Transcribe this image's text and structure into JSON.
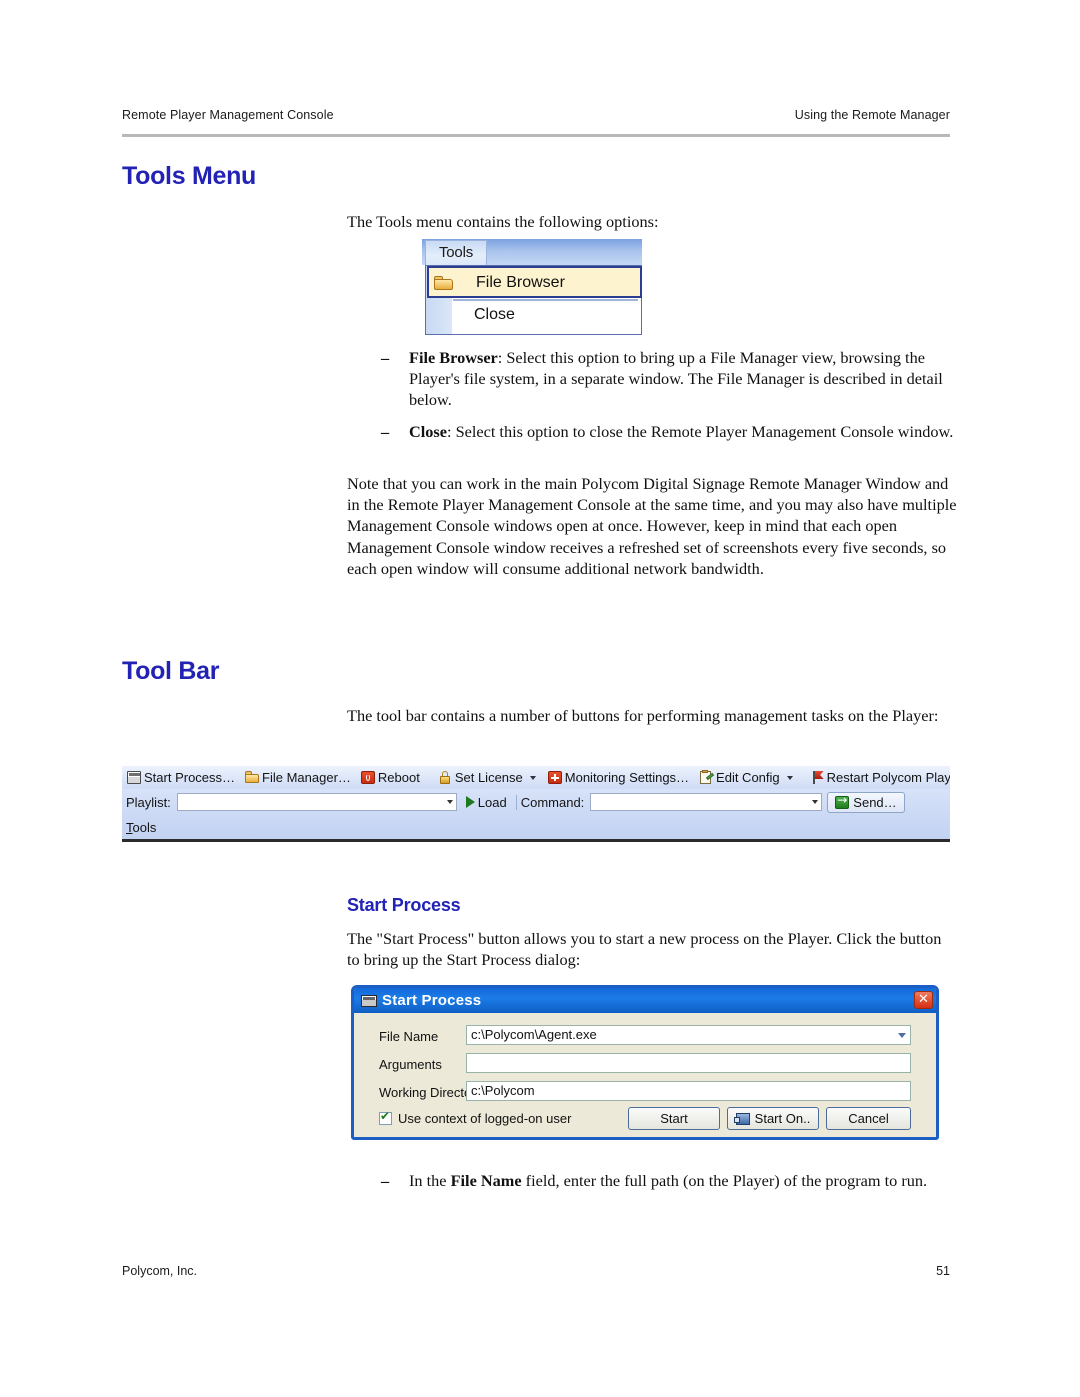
{
  "header": {
    "left": "Remote Player Management Console",
    "right": "Using the Remote Manager"
  },
  "footer": {
    "company": "Polycom, Inc.",
    "page_number": "51"
  },
  "sections": {
    "tools_menu": {
      "heading": "Tools Menu",
      "intro": "The Tools menu contains the following options:",
      "bullets": [
        {
          "term": "File Browser",
          "text": ": Select this option to bring up a File Manager view, browsing the Player's file system, in a separate window. The File Manager is described in detail below."
        },
        {
          "term": "Close",
          "text": ": Select this option to close the Remote Player Management Console window."
        }
      ],
      "note": "Note that you can work in the main Polycom Digital Signage Remote Manager Window and in the Remote Player Management Console at the same time, and you may also have multiple Management Console windows open at once. However, keep in mind that each open Management Console window receives a refreshed set of screenshots every five seconds, so each open window will consume additional network bandwidth."
    },
    "tool_bar": {
      "heading": "Tool Bar",
      "intro": "The tool bar contains a number of buttons for performing management tasks on the Player:"
    },
    "start_process": {
      "heading": "Start Process",
      "intro": "The \"Start Process\" button allows you to start a new process on the Player. Click the button to bring up the Start Process dialog:",
      "bullets": [
        {
          "term": "File Name",
          "prefix": "In the ",
          "text": " field, enter the full path (on the Player) of the program to run."
        }
      ]
    }
  },
  "tools_menu_screenshot": {
    "tab_label": "Tools",
    "items": [
      {
        "label": "File Browser",
        "icon": "folder-icon",
        "highlighted": true
      },
      {
        "label": "Close",
        "icon": "none",
        "highlighted": false
      }
    ]
  },
  "toolbar_screenshot": {
    "row1": [
      {
        "label": "Start Process…",
        "icon": "window-icon",
        "dropdown": false
      },
      {
        "label": "File Manager…",
        "icon": "folder-icon",
        "dropdown": false
      },
      {
        "label": "Reboot",
        "icon": "reboot-icon",
        "dropdown": false
      },
      {
        "label": "Set License",
        "icon": "lock-icon",
        "dropdown": true
      },
      {
        "label": "Monitoring Settings…",
        "icon": "health-icon",
        "dropdown": false
      },
      {
        "label": "Edit Config",
        "icon": "config-icon",
        "dropdown": true
      },
      {
        "label": "Restart Polycom Player",
        "icon": "flag-icon",
        "dropdown": false
      }
    ],
    "row2": {
      "playlist_label": "Playlist:",
      "playlist_value": "",
      "load_label": "Load",
      "command_label": "Command:",
      "command_value": "",
      "send_label": "Send…"
    },
    "row3": {
      "menu_label": "Tools",
      "menu_accel": "T",
      "menu_rest": "ools"
    }
  },
  "start_process_dialog": {
    "title": "Start Process",
    "close_label": "✕",
    "fields": [
      {
        "label": "File Name",
        "value": "c:\\Polycom\\Agent.exe",
        "dropdown": true
      },
      {
        "label": "Arguments",
        "value": "",
        "dropdown": false
      },
      {
        "label": "Working Directory",
        "value": "c:\\Polycom",
        "dropdown": false
      }
    ],
    "checkbox": {
      "label": "Use context of logged-on user",
      "checked": true
    },
    "buttons": [
      {
        "label": "Start",
        "icon": "none"
      },
      {
        "label": "Start On..",
        "icon": "monitor-icon"
      },
      {
        "label": "Cancel",
        "icon": "none"
      }
    ]
  },
  "colors": {
    "heading_blue": "#2222b5",
    "rule_gray": "#b8b8b8",
    "dialog_title_blue": "#1268d8",
    "highlight_yellow": "#fdf3cf"
  }
}
